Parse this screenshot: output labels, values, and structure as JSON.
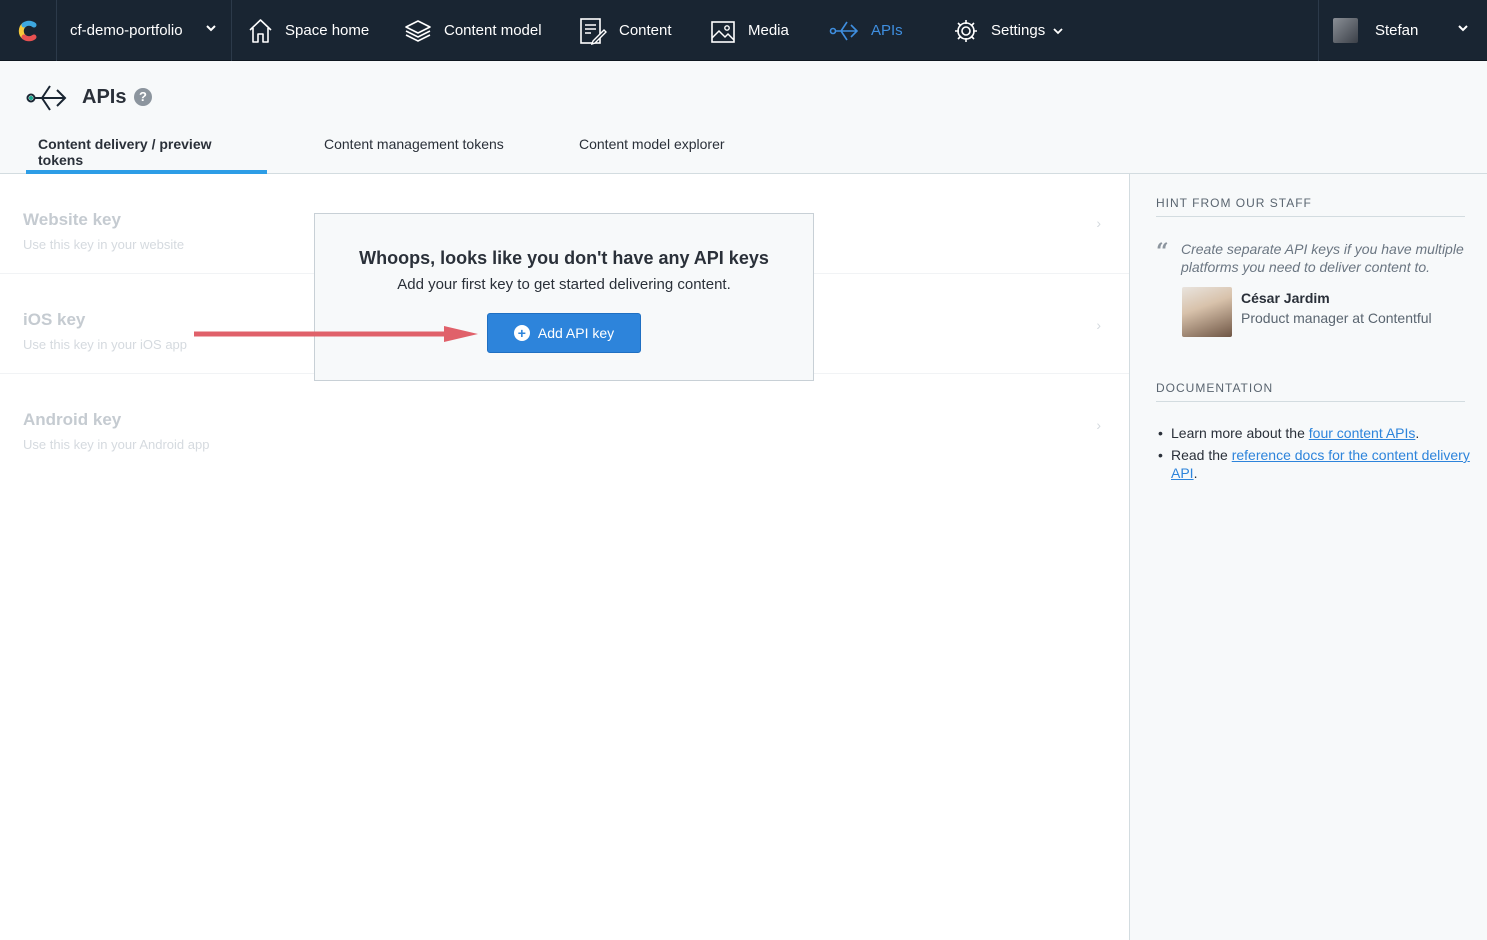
{
  "topbar": {
    "space_name": "cf-demo-portfolio",
    "nav": [
      {
        "label": "Space home",
        "icon": "home-icon"
      },
      {
        "label": "Content model",
        "icon": "layers-icon"
      },
      {
        "label": "Content",
        "icon": "content-edit-icon"
      },
      {
        "label": "Media",
        "icon": "image-icon"
      },
      {
        "label": "APIs",
        "icon": "api-icon",
        "active": true
      },
      {
        "label": "Settings",
        "icon": "gear-icon"
      }
    ],
    "user_name": "Stefan",
    "accent_color": "#3f8fe0"
  },
  "header": {
    "title": "APIs",
    "help": "?",
    "tabs": [
      {
        "label": "Content delivery / preview tokens",
        "active": true
      },
      {
        "label": "Content management tokens"
      },
      {
        "label": "Content model explorer"
      }
    ]
  },
  "keys": [
    {
      "title": "Website key",
      "desc": "Use this key in your website"
    },
    {
      "title": "iOS key",
      "desc": "Use this key in your iOS app"
    },
    {
      "title": "Android key",
      "desc": "Use this key in your Android app"
    }
  ],
  "empty_state": {
    "heading": "Whoops, looks like you don't have any API keys",
    "subtext": "Add your first key to get started delivering content.",
    "button_label": "Add API key"
  },
  "sidebar": {
    "hint_heading": "HINT FROM OUR STAFF",
    "hint_text": "Create separate API keys if you have multiple platforms you need to deliver content to.",
    "staff_name": "César Jardim",
    "staff_role": "Product manager at Contentful",
    "doc_heading": "DOCUMENTATION",
    "doc1_prefix": "Learn more about the ",
    "doc1_link": "four content APIs",
    "doc1_suffix": ".",
    "doc2_prefix": "Read the ",
    "doc2_link": "reference docs for the content delivery API",
    "doc2_suffix": "."
  }
}
